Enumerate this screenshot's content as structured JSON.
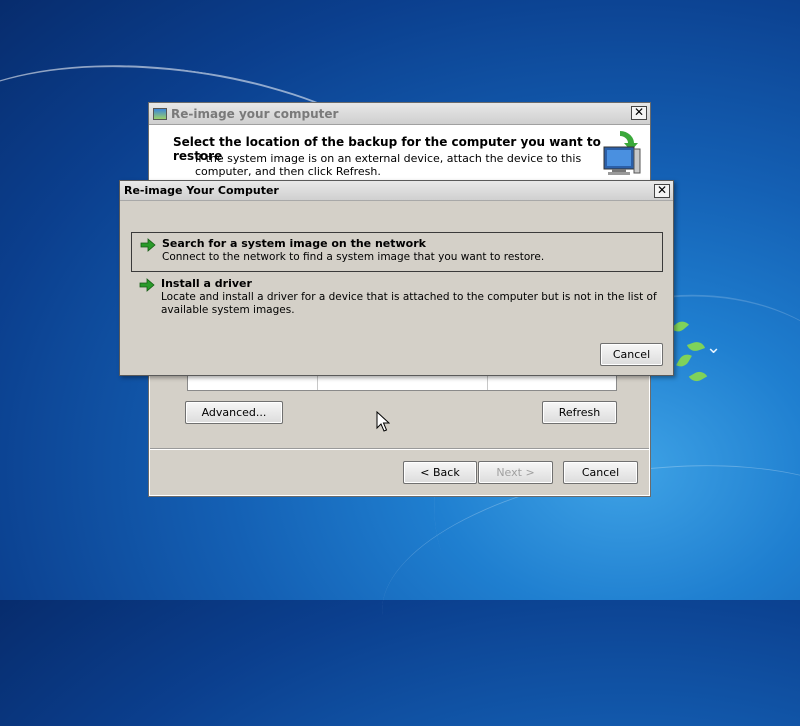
{
  "back_window": {
    "title": "Re-image your computer",
    "close_glyph": "✕",
    "header_title": "Select the location of the backup for the computer you want to restore",
    "header_desc": "If the system image is on an external device, attach the device to this computer, and then click Refresh.",
    "advanced_label": "Advanced...",
    "refresh_label": "Refresh",
    "back_label": "< Back",
    "next_label": "Next >",
    "cancel_label": "Cancel",
    "next_enabled": false
  },
  "front_dialog": {
    "title": "Re-image Your Computer",
    "close_glyph": "✕",
    "options": [
      {
        "title": "Search for a system image on the network",
        "desc": "Connect to the network to find a system image that you want to restore.",
        "selected": true,
        "icon": "green-arrow-icon"
      },
      {
        "title": "Install a driver",
        "desc": "Locate and install a driver for a device that is attached to the computer but is not in the list of available system images.",
        "selected": false,
        "icon": "green-arrow-icon"
      }
    ],
    "cancel_label": "Cancel"
  },
  "colors": {
    "desktop_blue": "#1460b4",
    "dialog_gray": "#d4d0c8",
    "arrow_green": "#2a9a2a"
  }
}
